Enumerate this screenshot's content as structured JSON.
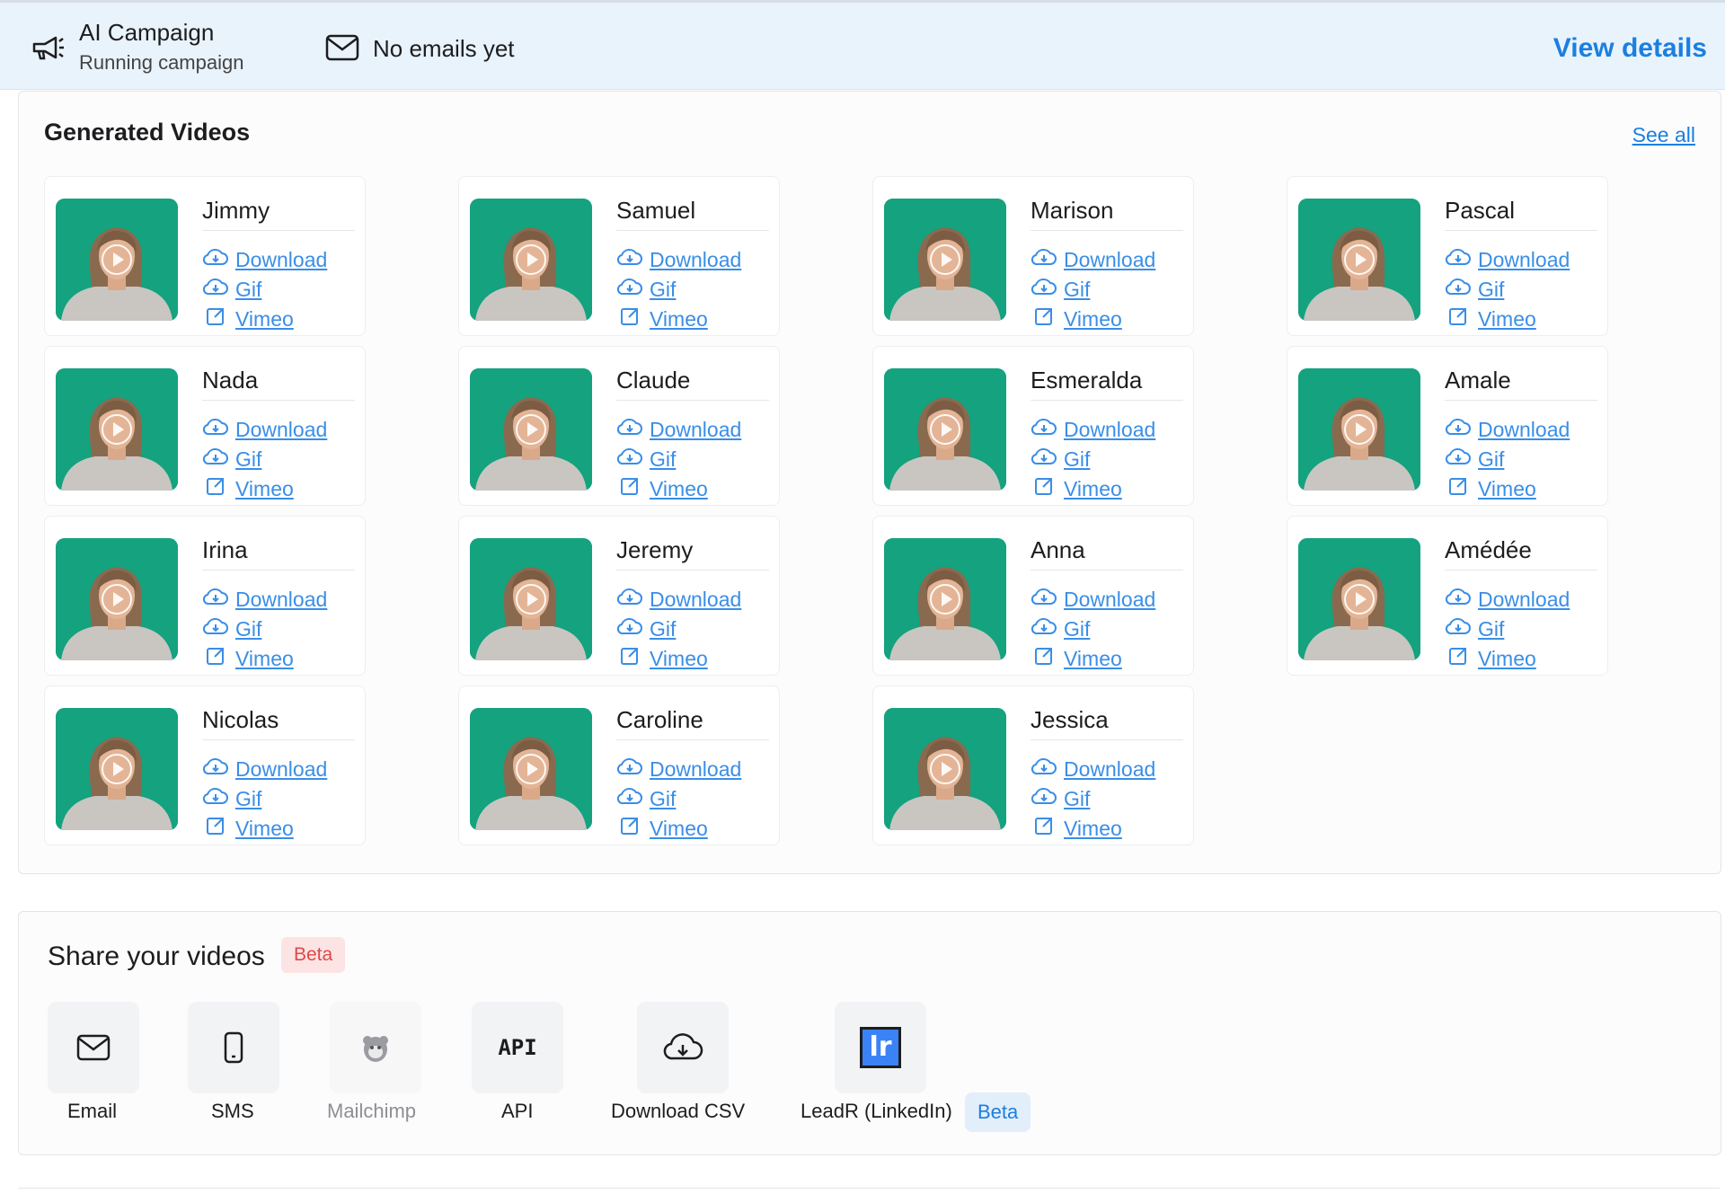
{
  "header": {
    "campaign_title": "AI Campaign",
    "campaign_status": "Running campaign",
    "emails_status": "No emails yet",
    "view_details": "View details"
  },
  "videos": {
    "title": "Generated Videos",
    "see_all": "See all",
    "link_labels": {
      "download": "Download",
      "gif": "Gif",
      "vimeo": "Vimeo"
    },
    "thumbnail_bg": "#14a27f",
    "people": [
      "Jimmy",
      "Samuel",
      "Marison",
      "Pascal",
      "Nada",
      "Claude",
      "Esmeralda",
      "Amale",
      "Irina",
      "Jeremy",
      "Anna",
      "Amédée",
      "Nicolas",
      "Caroline",
      "Jessica"
    ]
  },
  "share": {
    "title": "Share your videos",
    "beta": "Beta",
    "items": [
      {
        "label": "Email",
        "icon": "mail-icon"
      },
      {
        "label": "SMS",
        "icon": "phone-icon"
      },
      {
        "label": "Mailchimp",
        "icon": "mailchimp-icon"
      },
      {
        "label": "API",
        "icon": "api-icon"
      },
      {
        "label": "Download CSV",
        "icon": "cloud-download-icon"
      },
      {
        "label": "LeadR (LinkedIn)",
        "icon": "leadr-logo-icon"
      }
    ],
    "leadr_beta": "Beta",
    "leadr_logo_text": "lr"
  }
}
